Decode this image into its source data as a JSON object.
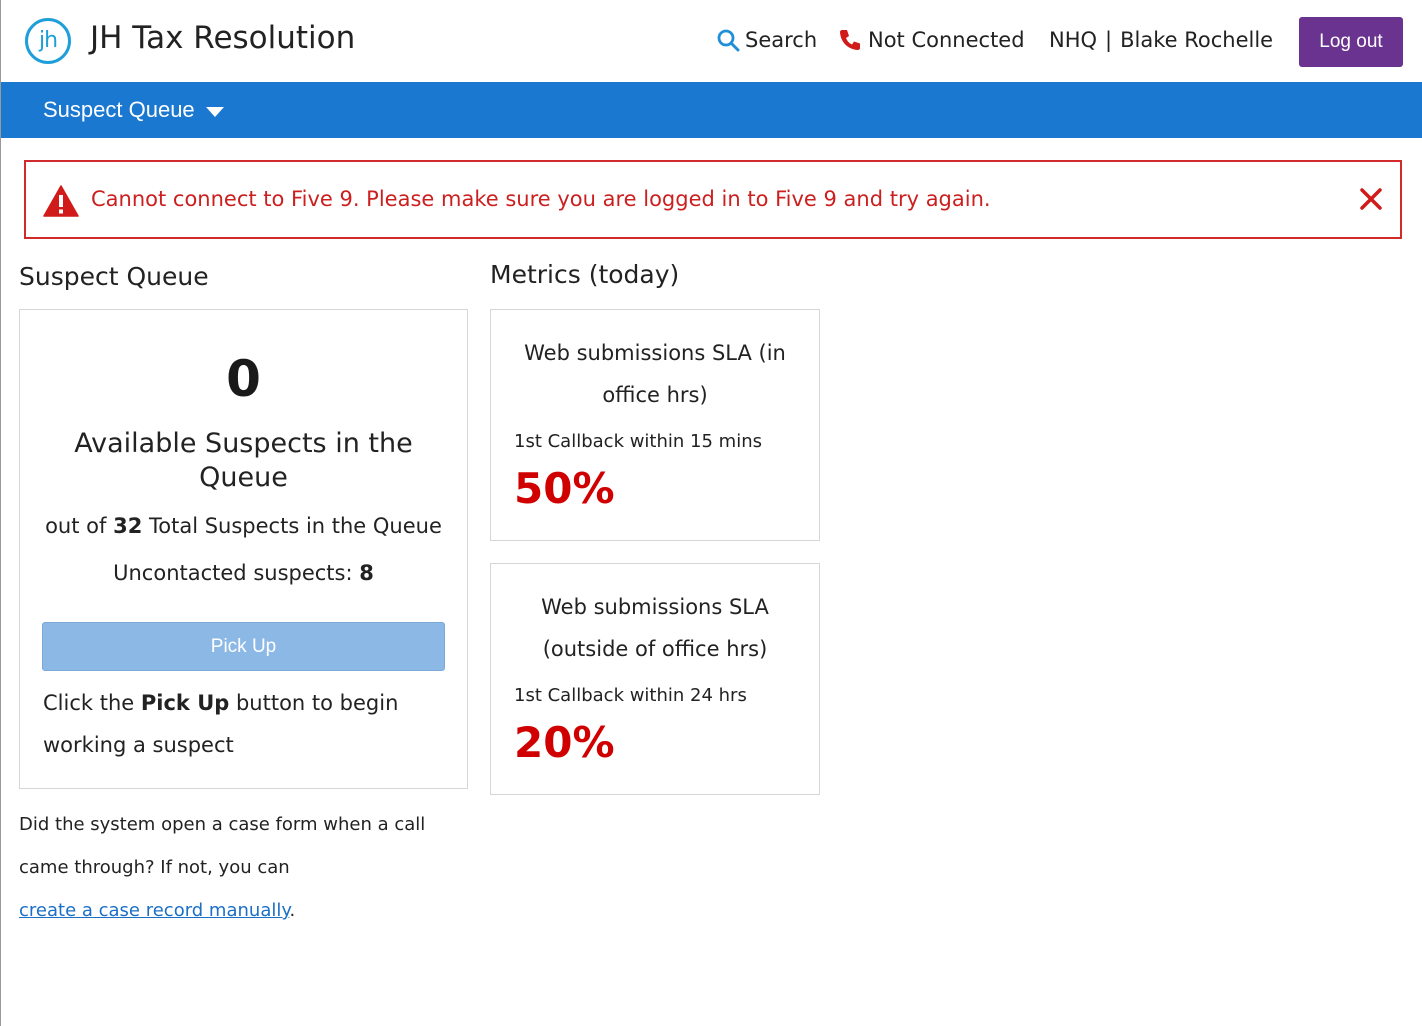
{
  "header": {
    "logo_text": "jh",
    "app_title": "JH Tax Resolution",
    "search_label": "Search",
    "phone_status": "Not Connected",
    "org": "NHQ",
    "separator": "|",
    "user_name": "Blake Rochelle",
    "logout_label": "Log out"
  },
  "nav": {
    "dropdown_label": "Suspect Queue"
  },
  "alert": {
    "message": "Cannot connect to Five 9. Please make sure you are logged in to Five 9 and try again."
  },
  "queue": {
    "section_title": "Suspect Queue",
    "available_count": "0",
    "available_label": "Available Suspects in the Queue",
    "total_prefix": "out of",
    "total_count": "32",
    "total_suffix": "Total Suspects in the Queue",
    "uncontacted_label": "Uncontacted suspects:",
    "uncontacted_count": "8",
    "pickup_label": "Pick Up",
    "help_prefix": "Click the",
    "help_bold": "Pick Up",
    "help_suffix": "button to begin working a suspect"
  },
  "manual_case": {
    "text": "Did the system open a case form when a call came through? If not, you can",
    "link_text": "create a case record manually",
    "trailing": "."
  },
  "metrics": {
    "section_title": "Metrics (today)",
    "cards": [
      {
        "title": "Web submissions SLA (in office hrs)",
        "subtitle": "1st Callback within 15 mins",
        "value": "50%"
      },
      {
        "title": "Web submissions SLA (outside of office hrs)",
        "subtitle": "1st Callback within 24 hrs",
        "value": "20%"
      }
    ]
  },
  "colors": {
    "nav_blue": "#1a78d0",
    "logout_purple": "#6a3390",
    "alert_red": "#cc1f1f",
    "metric_red": "#d10000",
    "pickup_disabled_blue": "#8cb8e6",
    "link_blue": "#1a6fc7",
    "logo_blue": "#1e9fd9"
  },
  "icons": {
    "logo": "jh-logo-icon",
    "search": "search-icon",
    "phone": "phone-icon",
    "caret": "caret-down-icon",
    "alert": "warning-triangle-icon",
    "close": "close-icon"
  }
}
